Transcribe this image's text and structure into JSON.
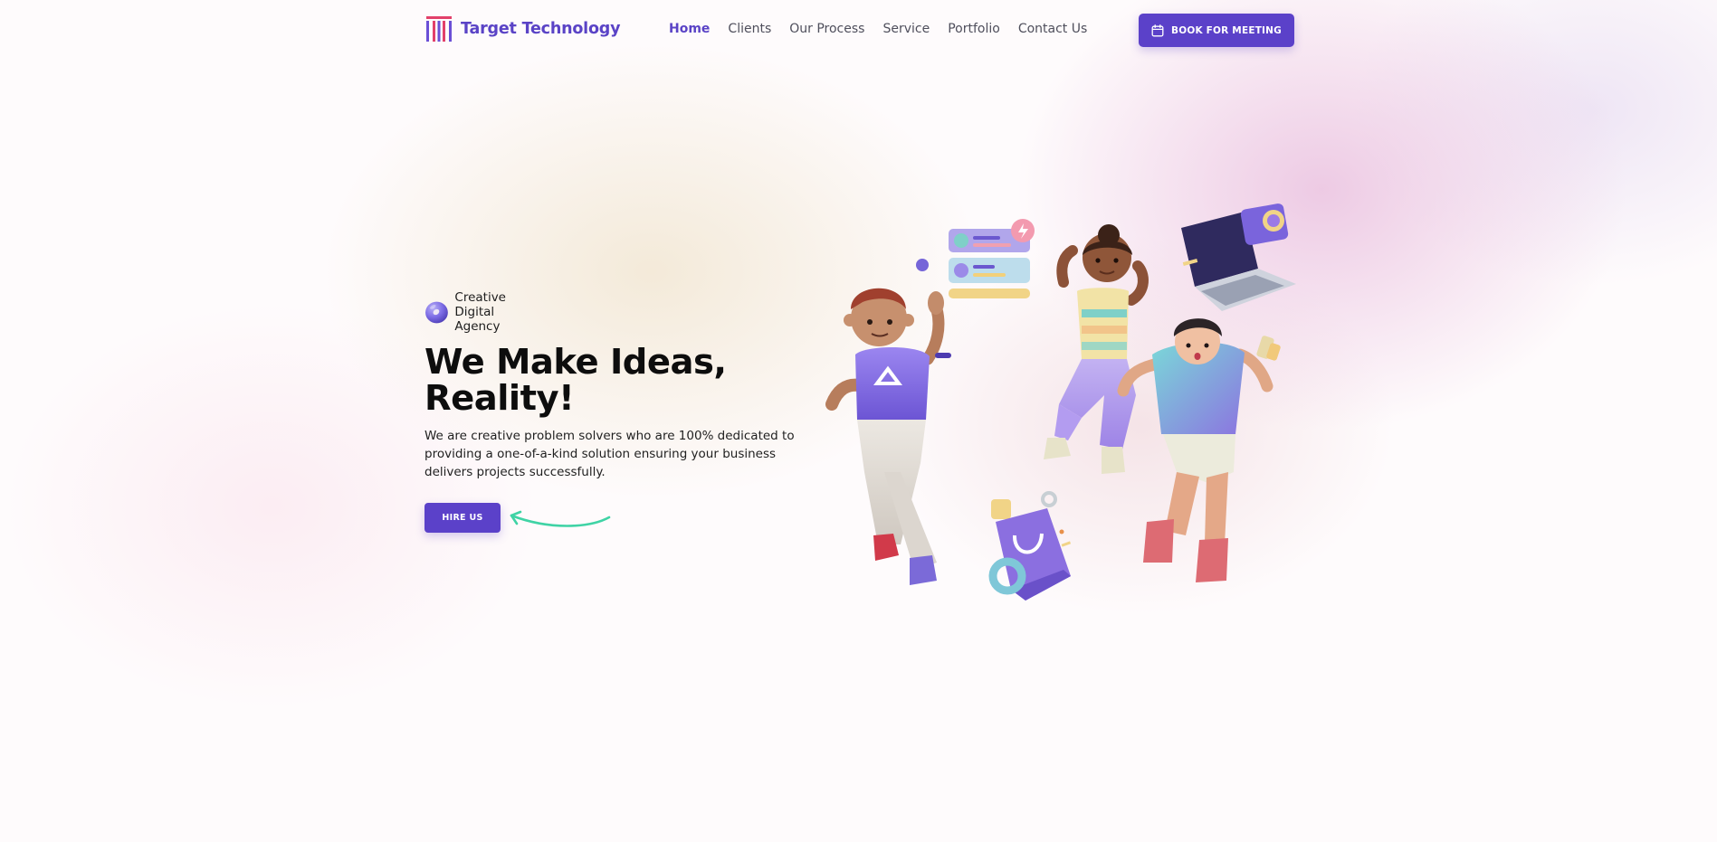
{
  "header": {
    "brand": "Target Technology",
    "logo_icon": "stylized-T-logo-icon",
    "nav": [
      {
        "label": "Home",
        "active": true
      },
      {
        "label": "Clients",
        "active": false
      },
      {
        "label": "Our Process",
        "active": false
      },
      {
        "label": "Service",
        "active": false
      },
      {
        "label": "Portfolio",
        "active": false
      },
      {
        "label": "Contact Us",
        "active": false
      }
    ],
    "cta": {
      "label": "BOOK FOR MEETING",
      "icon": "calendar-icon"
    }
  },
  "hero": {
    "tagline": "Creative Digital Agency",
    "headline": "We Make Ideas, Reality!",
    "subtext": "We are creative problem solvers who are 100% dedicated to providing a one-of-a-kind solution ensuring your business delivers projects successfully.",
    "button": "HIRE US",
    "illustration": "3d-characters-illustration"
  },
  "colors": {
    "accent": "#5b41c9",
    "brand_text": "#5a43c6",
    "arrow": "#3fd3a5",
    "heading": "#0d0d0d"
  }
}
